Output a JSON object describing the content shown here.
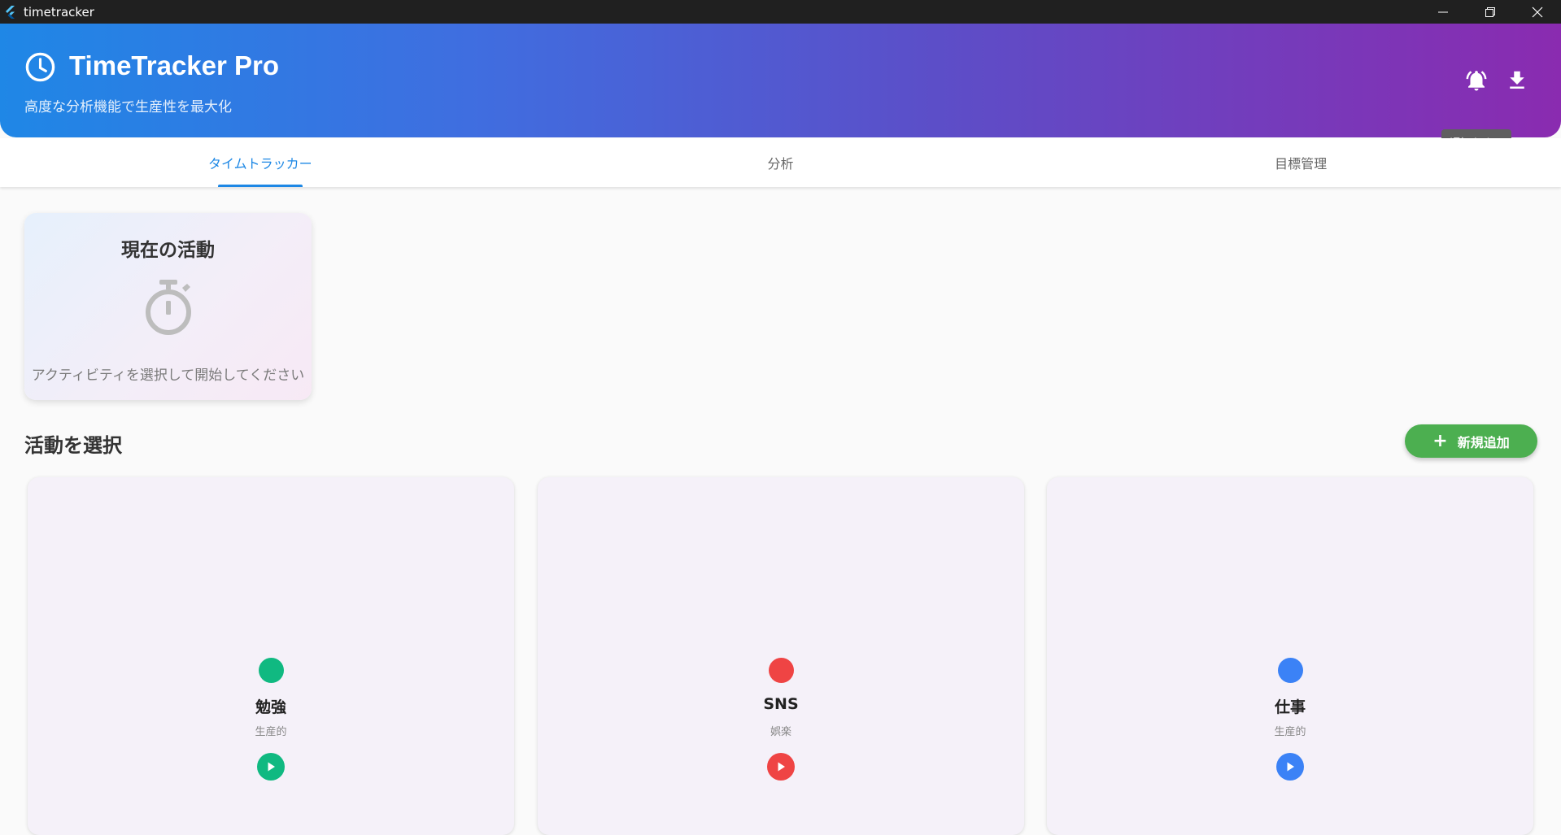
{
  "window": {
    "title": "timetracker"
  },
  "header": {
    "title": "TimeTracker Pro",
    "subtitle": "高度な分析機能で生産性を最大化",
    "tooltip": "通知をオフ"
  },
  "tabs": [
    {
      "label": "タイムトラッカー",
      "active": true
    },
    {
      "label": "分析",
      "active": false
    },
    {
      "label": "目標管理",
      "active": false
    }
  ],
  "current_activity": {
    "title": "現在の活動",
    "hint": "アクティビティを選択して開始してください"
  },
  "section": {
    "title": "活動を選択",
    "add_label": "新規追加"
  },
  "activities": [
    {
      "name": "勉強",
      "category": "生産的",
      "color": "#10b981"
    },
    {
      "name": "SNS",
      "category": "娯楽",
      "color": "#ef4444"
    },
    {
      "name": "仕事",
      "category": "生産的",
      "color": "#3b82f6"
    }
  ],
  "colors": {
    "accent": "#1e88e5",
    "add_button": "#4caf50",
    "header_gradient": [
      "#1f87e6",
      "#8a2bb0"
    ]
  }
}
